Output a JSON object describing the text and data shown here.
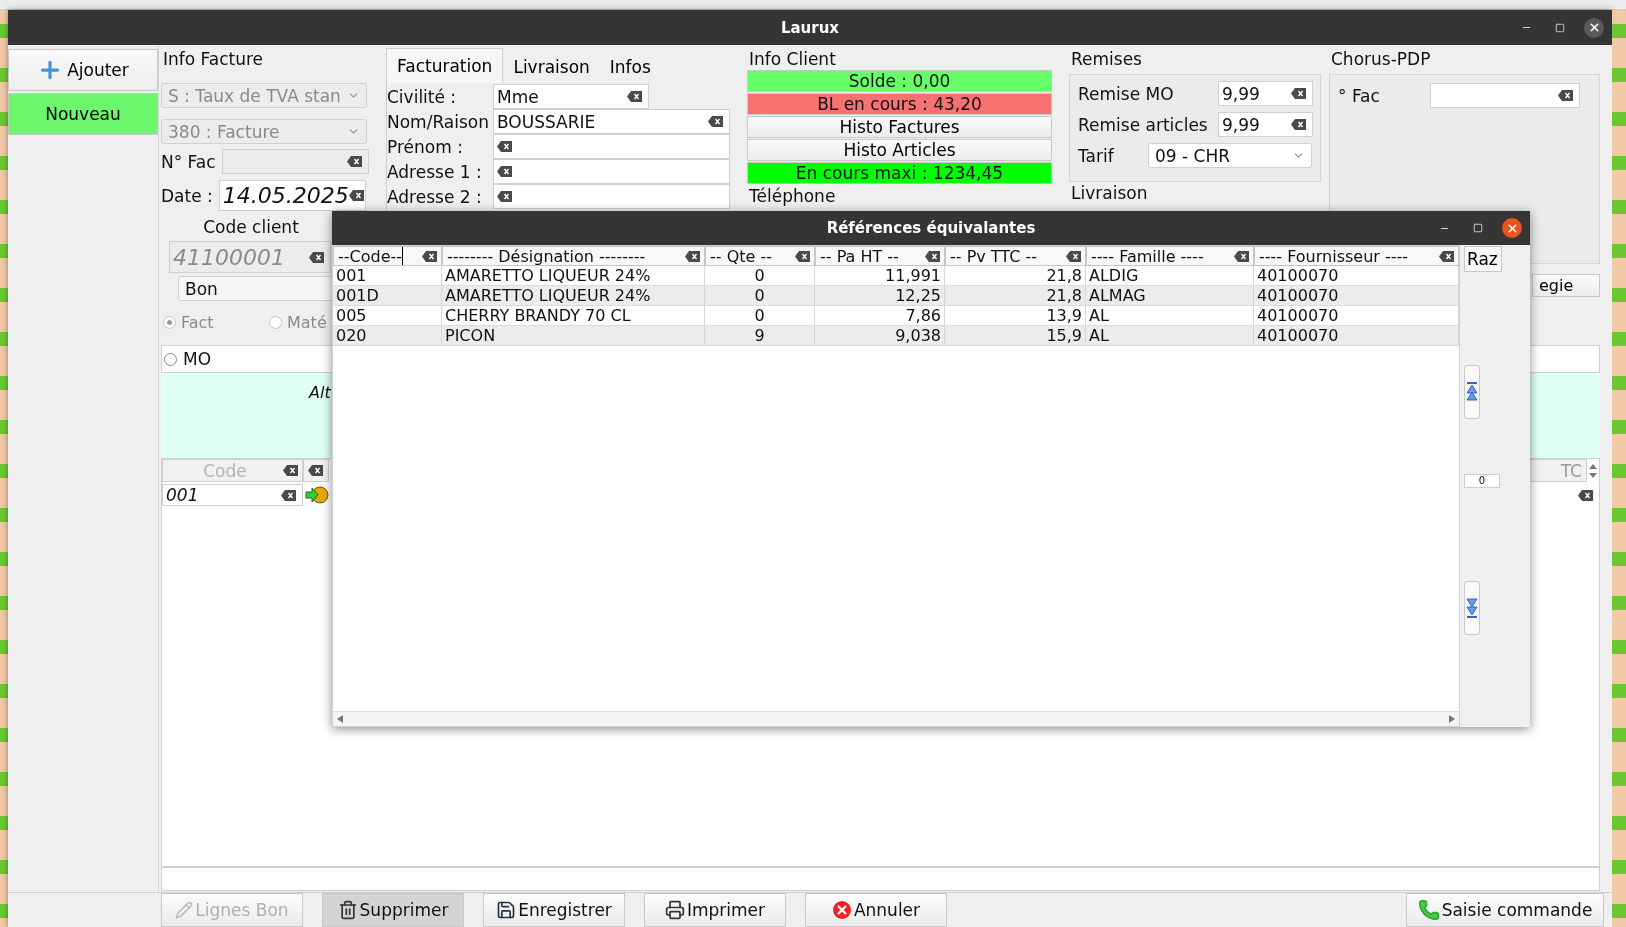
{
  "window": {
    "title": "Laurux"
  },
  "sidebar": [
    {
      "label": "Ajouter",
      "kind": "add"
    },
    {
      "label": "Nouveau",
      "kind": "primary"
    }
  ],
  "info_facture": {
    "title": "Info Facture",
    "selects": [
      {
        "value": "S : Taux de TVA stan",
        "disabled": true
      },
      {
        "value": "380 : Facture",
        "disabled": true
      }
    ],
    "n_fac": {
      "label": "N° Fac"
    },
    "date": {
      "label": "Date :",
      "value": "14.05.2025"
    },
    "code_client": {
      "label": "Code client",
      "value": "41100001",
      "disabled": true
    },
    "doc_select": {
      "value": "Bon"
    },
    "radios": [
      {
        "label": "Fact",
        "selected": true
      },
      {
        "label": "Maté",
        "selected": false
      }
    ],
    "mo": {
      "label": "MO",
      "checked": false
    },
    "note": "Alt"
  },
  "client_tabs": [
    {
      "label": "Facturation",
      "selected": true
    },
    {
      "label": "Livraison",
      "selected": false
    },
    {
      "label": "Infos",
      "selected": false
    }
  ],
  "client_fields": [
    {
      "label": "Civilité :",
      "value": "Mme"
    },
    {
      "label": "Nom/Raison",
      "value": "BOUSSARIE"
    },
    {
      "label": "Prénom :"
    },
    {
      "label": "Adresse 1 :"
    },
    {
      "label": "Adresse 2 :"
    }
  ],
  "info_client": {
    "title": "Info Client",
    "items": [
      {
        "text": "Solde : 0,00",
        "kind": "status",
        "color": "#66ff66"
      },
      {
        "text": "BL en cours : 43,20",
        "kind": "status",
        "color": "#f87272"
      },
      {
        "text": "Histo Factures",
        "kind": "button"
      },
      {
        "text": "Histo Articles",
        "kind": "button"
      },
      {
        "text": "En cours maxi : 1234,45",
        "kind": "status",
        "color": "#00ff00"
      }
    ],
    "phone_label": "Téléphone"
  },
  "remises": {
    "title": "Remises",
    "fields": [
      {
        "label": "Remise MO",
        "value": "9,99"
      },
      {
        "label": "Remise articles",
        "value": "9,99"
      }
    ],
    "tarif": {
      "label": "Tarif",
      "value": "09 - CHR"
    },
    "livraison_label": "Livraison"
  },
  "chorus": {
    "title": "Chorus-PDP",
    "n_fac_label": "° Fac",
    "side_button": "egie"
  },
  "lines_grid": {
    "code_header": "Code",
    "right_header": "TC",
    "row_code": "001"
  },
  "dialog": {
    "title": "Références équivalantes",
    "columns": [
      "--Code--",
      "-------- Désignation --------",
      "-- Qte --",
      "-- Pa  HT --",
      "-- Pv  TTC --",
      "---- Famille ----",
      "---- Fournisseur ----"
    ],
    "rows": [
      [
        "001",
        "AMARETTO LIQUEUR 24%",
        "0",
        "11,991",
        "21,8",
        "ALDIG",
        "40100070"
      ],
      [
        "001D",
        "AMARETTO LIQUEUR 24%",
        "0",
        "12,25",
        "21,8",
        "ALMAG",
        "40100070"
      ],
      [
        "005",
        "CHERRY BRANDY 70 CL",
        "0",
        "7,86",
        "13,9",
        "AL",
        "40100070"
      ],
      [
        "020",
        "PICON",
        "9",
        "9,038",
        "15,9",
        "AL",
        "40100070"
      ]
    ],
    "raz": "Raz",
    "counter": "0"
  },
  "bottom_buttons": [
    {
      "label": "Lignes Bon",
      "kind": "edit",
      "disabled": true,
      "active": false
    },
    {
      "label": "Supprimer",
      "kind": "delete",
      "disabled": false,
      "active": true
    },
    {
      "label": "Enregistrer",
      "kind": "save",
      "disabled": false,
      "active": false
    },
    {
      "label": "Imprimer",
      "kind": "print",
      "disabled": false,
      "active": false
    },
    {
      "label": "Annuler",
      "kind": "cancel",
      "disabled": false,
      "active": false
    },
    {
      "label": "Saisie commande",
      "kind": "order",
      "disabled": false,
      "active": false
    }
  ]
}
